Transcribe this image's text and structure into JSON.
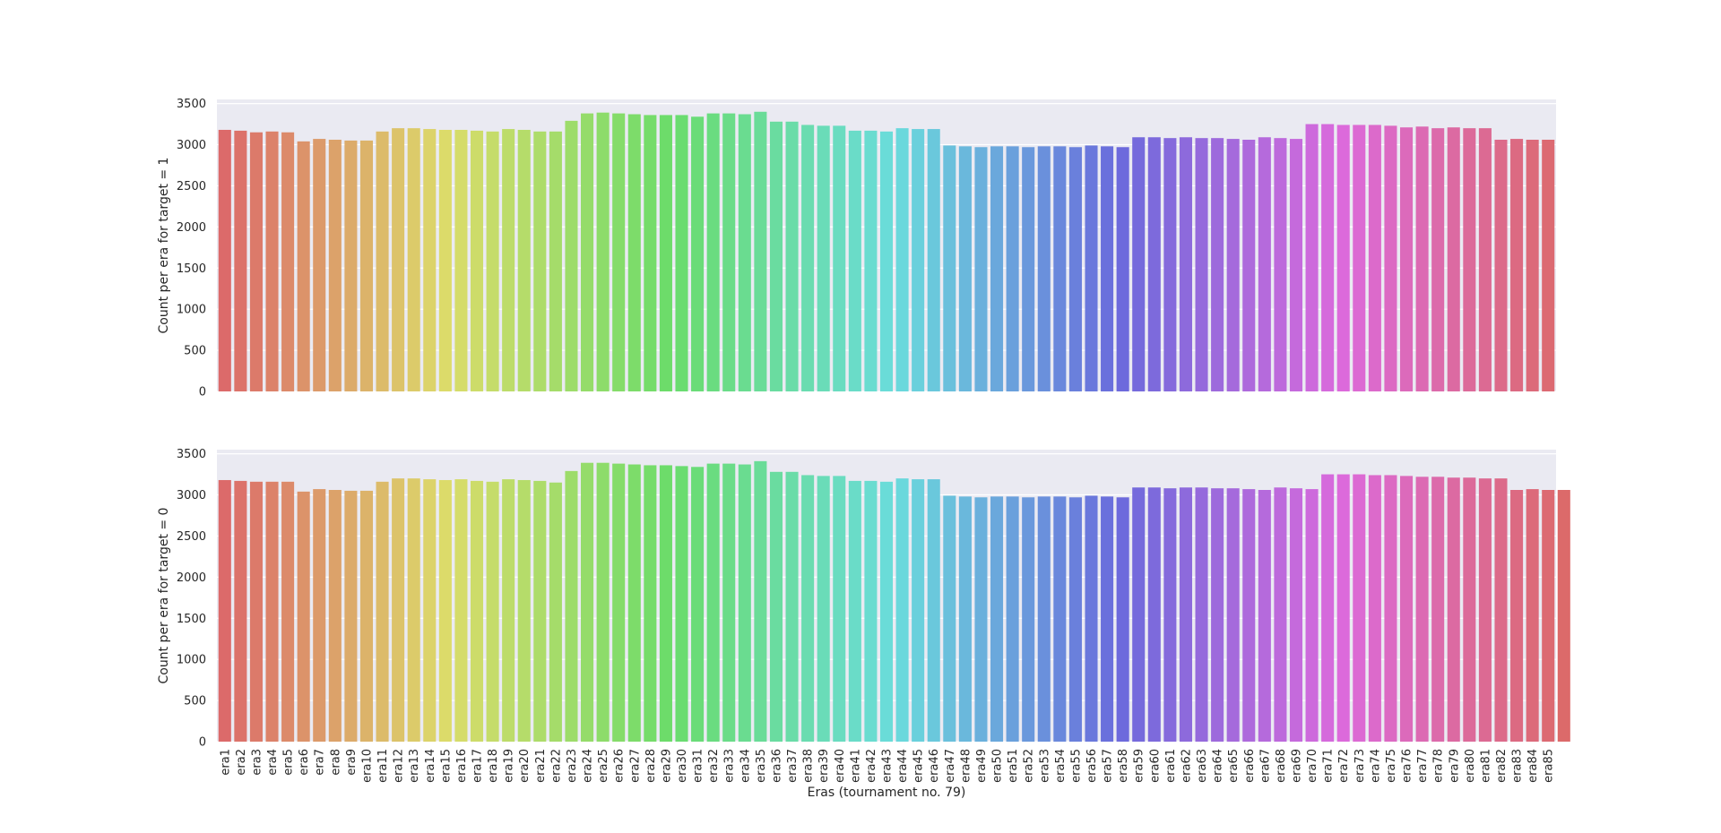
{
  "chart_data": [
    {
      "type": "bar",
      "ylabel": "Count per era for target = 1",
      "xlabel": "",
      "ylim": [
        0,
        3550
      ],
      "yticks": [
        0,
        500,
        1000,
        1500,
        2000,
        2500,
        3000,
        3500
      ],
      "grid": true,
      "categories": [
        "era1",
        "era2",
        "era3",
        "era4",
        "era5",
        "era6",
        "era7",
        "era8",
        "era9",
        "era10",
        "era11",
        "era12",
        "era13",
        "era14",
        "era15",
        "era16",
        "era17",
        "era18",
        "era19",
        "era20",
        "era21",
        "era22",
        "era23",
        "era24",
        "era25",
        "era26",
        "era27",
        "era28",
        "era29",
        "era30",
        "era31",
        "era32",
        "era33",
        "era34",
        "era35",
        "era36",
        "era37",
        "era38",
        "era39",
        "era40",
        "era41",
        "era42",
        "era43",
        "era44",
        "era45",
        "era46",
        "era47",
        "era48",
        "era49",
        "era50",
        "era51",
        "era52",
        "era53",
        "era54",
        "era55",
        "era56",
        "era57",
        "era58",
        "era59",
        "era60",
        "era61",
        "era62",
        "era63",
        "era64",
        "era65",
        "era66",
        "era67",
        "era68",
        "era69",
        "era70",
        "era71",
        "era72",
        "era73",
        "era74",
        "era75",
        "era76",
        "era77",
        "era78",
        "era79",
        "era80",
        "era81",
        "era82",
        "era83",
        "era84",
        "era85"
      ],
      "values": [
        3180,
        3170,
        3150,
        3160,
        3150,
        3040,
        3070,
        3060,
        3050,
        3050,
        3160,
        3200,
        3200,
        3190,
        3180,
        3180,
        3170,
        3160,
        3190,
        3180,
        3160,
        3160,
        3290,
        3380,
        3390,
        3380,
        3370,
        3360,
        3360,
        3360,
        3340,
        3380,
        3380,
        3370,
        3400,
        3280,
        3280,
        3240,
        3230,
        3230,
        3170,
        3170,
        3160,
        3200,
        3190,
        3190,
        2990,
        2980,
        2970,
        2980,
        2980,
        2970,
        2980,
        2980,
        2970,
        2990,
        2980,
        2970,
        3090,
        3090,
        3080,
        3090,
        3080,
        3080,
        3070,
        3060,
        3090,
        3080,
        3070,
        3250,
        3250,
        3240,
        3240,
        3240,
        3230,
        3210,
        3220,
        3200,
        3210,
        3200,
        3200,
        3060,
        3070,
        3060,
        3060
      ]
    },
    {
      "type": "bar",
      "ylabel": "Count per era for target = 0",
      "xlabel": "Eras (tournament no. 79)",
      "ylim": [
        0,
        3550
      ],
      "yticks": [
        0,
        500,
        1000,
        1500,
        2000,
        2500,
        3000,
        3500
      ],
      "grid": true,
      "categories": [
        "era1",
        "era2",
        "era3",
        "era4",
        "era5",
        "era6",
        "era7",
        "era8",
        "era9",
        "era10",
        "era11",
        "era12",
        "era13",
        "era14",
        "era15",
        "era16",
        "era17",
        "era18",
        "era19",
        "era20",
        "era21",
        "era22",
        "era23",
        "era24",
        "era25",
        "era26",
        "era27",
        "era28",
        "era29",
        "era30",
        "era31",
        "era32",
        "era33",
        "era34",
        "era35",
        "era36",
        "era37",
        "era38",
        "era39",
        "era40",
        "era41",
        "era42",
        "era43",
        "era44",
        "era45",
        "era46",
        "era47",
        "era48",
        "era49",
        "era50",
        "era51",
        "era52",
        "era53",
        "era54",
        "era55",
        "era56",
        "era57",
        "era58",
        "era59",
        "era60",
        "era61",
        "era62",
        "era63",
        "era64",
        "era65",
        "era66",
        "era67",
        "era68",
        "era69",
        "era70",
        "era71",
        "era72",
        "era73",
        "era74",
        "era75",
        "era76",
        "era77",
        "era78",
        "era79",
        "era80",
        "era81",
        "era82",
        "era83",
        "era84",
        "era85"
      ],
      "values": [
        3180,
        3170,
        3160,
        3160,
        3160,
        3040,
        3070,
        3060,
        3050,
        3050,
        3160,
        3200,
        3200,
        3190,
        3180,
        3190,
        3170,
        3160,
        3190,
        3180,
        3170,
        3150,
        3290,
        3390,
        3390,
        3380,
        3370,
        3360,
        3360,
        3350,
        3340,
        3380,
        3380,
        3370,
        3410,
        3280,
        3280,
        3240,
        3230,
        3230,
        3170,
        3170,
        3160,
        3200,
        3190,
        3190,
        2990,
        2980,
        2970,
        2980,
        2980,
        2970,
        2980,
        2980,
        2970,
        2990,
        2980,
        2970,
        3090,
        3090,
        3080,
        3090,
        3090,
        3080,
        3080,
        3070,
        3060,
        3090,
        3080,
        3070,
        3250,
        3250,
        3250,
        3240,
        3240,
        3230,
        3220,
        3220,
        3210,
        3210,
        3200,
        3200,
        3060,
        3070,
        3060,
        3060
      ]
    }
  ]
}
